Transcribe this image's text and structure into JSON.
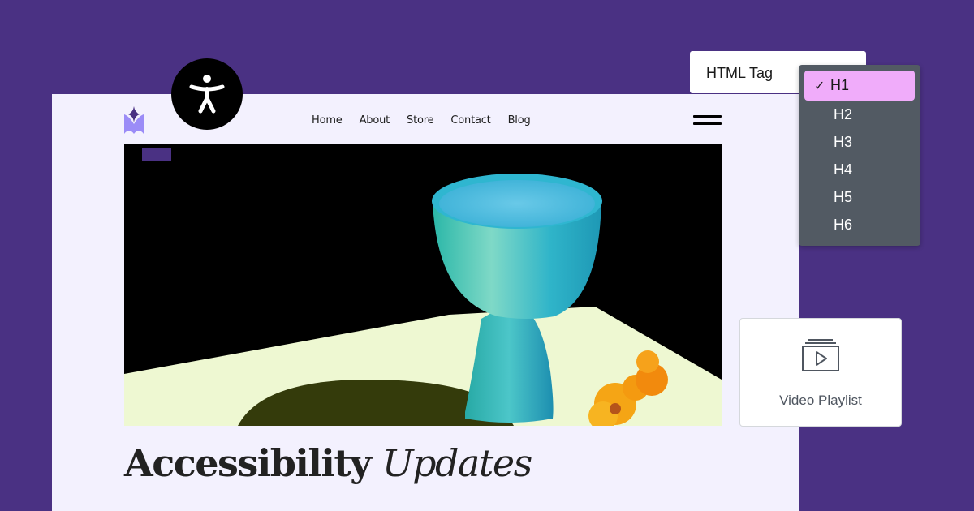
{
  "site": {
    "logo_icon": "sparkle-logo-icon",
    "accessibility_badge_icon": "accessibility-person-icon",
    "nav": [
      {
        "label": "Home"
      },
      {
        "label": "About"
      },
      {
        "label": "Store"
      },
      {
        "label": "Contact"
      },
      {
        "label": "Blog"
      }
    ],
    "menu_icon": "hamburger-menu-icon",
    "hero_image": {
      "description": "Turquoise ceramic goblet on pale green table with orange nasturtium flowers against black background"
    },
    "headline": {
      "bold": "Accessibility",
      "italic": "Updates"
    }
  },
  "html_tag_control": {
    "label": "HTML Tag",
    "selected": "H1",
    "options": [
      {
        "label": "H1",
        "selected": true
      },
      {
        "label": "H2",
        "selected": false
      },
      {
        "label": "H3",
        "selected": false
      },
      {
        "label": "H4",
        "selected": false
      },
      {
        "label": "H5",
        "selected": false
      },
      {
        "label": "H6",
        "selected": false
      }
    ],
    "check_glyph": "✓"
  },
  "widget": {
    "icon": "video-playlist-icon",
    "label": "Video Playlist"
  },
  "colors": {
    "background": "#4a3183",
    "card": "#f3f1fe",
    "dropdown_bg": "#525a63",
    "selected_option": "#f0acfa",
    "logo_dark": "#4a3183",
    "logo_light": "#9b8cf7"
  }
}
